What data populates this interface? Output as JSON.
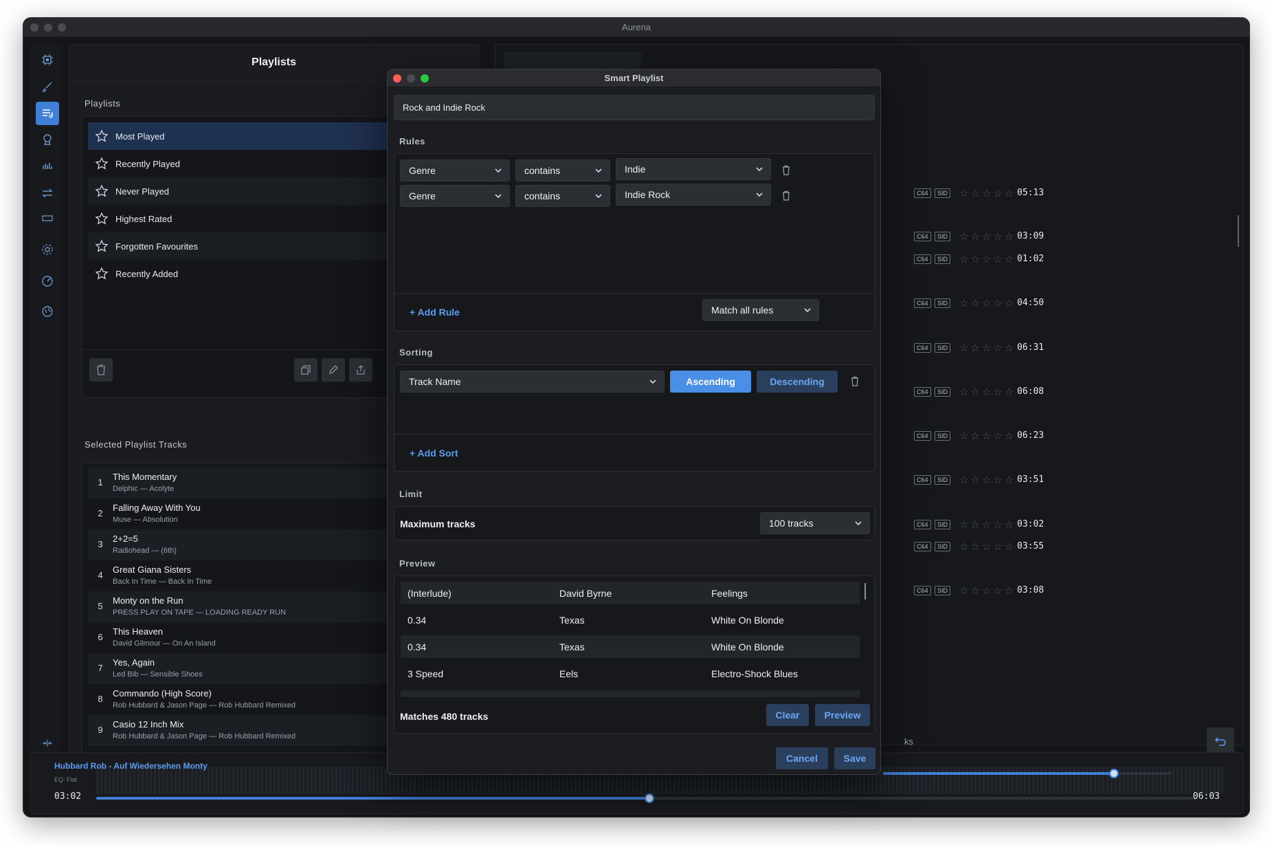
{
  "window": {
    "title": "Aurena"
  },
  "rail": {
    "icons": [
      "cpu-icon",
      "brush-icon",
      "playlist-icon",
      "library-icon",
      "equalizer-icon",
      "transfer-icon",
      "display-icon",
      "settings-icon",
      "dial-icon",
      "globe-icon",
      "collapse-icon"
    ]
  },
  "playlists_panel": {
    "header": "Playlists",
    "section_label": "Playlists",
    "items": [
      {
        "label": "Most Played"
      },
      {
        "label": "Recently Played"
      },
      {
        "label": "Never Played"
      },
      {
        "label": "Highest Rated"
      },
      {
        "label": "Forgotten Favourites"
      },
      {
        "label": "Recently Added"
      }
    ],
    "tracks_label": "Selected Playlist Tracks",
    "tracks": [
      {
        "num": "1",
        "title": "This Momentary",
        "sub": "Delphic — Acolyte"
      },
      {
        "num": "2",
        "title": "Falling Away With You",
        "sub": "Muse — Absolution"
      },
      {
        "num": "3",
        "title": "2+2=5",
        "sub": "Radiohead — (6th)"
      },
      {
        "num": "4",
        "title": "Great Giana Sisters",
        "sub": "Back In Time — Back In Time"
      },
      {
        "num": "5",
        "title": "Monty on the Run",
        "sub": "PRESS PLAY ON TAPE — LOADING READY RUN"
      },
      {
        "num": "6",
        "title": "This Heaven",
        "sub": "David Gilmour — On An Island"
      },
      {
        "num": "7",
        "title": "Yes, Again",
        "sub": "Led Bib — Sensible Shoes"
      },
      {
        "num": "8",
        "title": "Commando (High Score)",
        "sub": "Rob Hubbard & Jason Page — Rob Hubbard Remixed"
      },
      {
        "num": "9",
        "title": "Casio 12 Inch Mix",
        "sub": "Rob Hubbard & Jason Page — Rob Hubbard Remixed"
      }
    ]
  },
  "right_panel": {
    "badges": [
      "C64",
      "SID"
    ],
    "stars": "☆☆☆☆☆",
    "times": [
      "05:13",
      "03:09",
      "01:02",
      "04:50",
      "06:31",
      "06:08",
      "06:23",
      "03:51",
      "03:02",
      "03:55",
      "03:08"
    ],
    "partial_text": "ks"
  },
  "player": {
    "now_playing": "Hubbard Rob - Auf Wiedersehen Monty",
    "eq": "EQ: Flat",
    "elapsed": "03:02",
    "duration": "06:03",
    "progress": 0.503,
    "volume": 0.8
  },
  "modal": {
    "title": "Smart Playlist",
    "name": "Rock and Indie Rock",
    "rules_label": "Rules",
    "rules": [
      {
        "field": "Genre",
        "op": "contains",
        "value": "Indie"
      },
      {
        "field": "Genre",
        "op": "contains",
        "value": "Indie Rock"
      }
    ],
    "add_rule": "+ Add Rule",
    "match_mode": "Match all rules",
    "sorting_label": "Sorting",
    "sort_field": "Track Name",
    "ascending": "Ascending",
    "descending": "Descending",
    "add_sort": "+ Add Sort",
    "limit_label": "Limit",
    "max_tracks_label": "Maximum tracks",
    "max_tracks_value": "100 tracks",
    "preview_label": "Preview",
    "preview_rows": [
      {
        "track": "(Interlude)",
        "artist": "David Byrne",
        "album": "Feelings"
      },
      {
        "track": "0.34",
        "artist": "Texas",
        "album": "White On Blonde"
      },
      {
        "track": "0.34",
        "artist": "Texas",
        "album": "White On Blonde"
      },
      {
        "track": "3 Speed",
        "artist": "Eels",
        "album": "Electro-Shock Blues"
      }
    ],
    "matches": "Matches 480 tracks",
    "clear": "Clear",
    "preview_btn": "Preview",
    "cancel": "Cancel",
    "save": "Save",
    "colors": {
      "accent": "#4a8fe6",
      "close": "#ff5f57",
      "minimize": "#4a4c50",
      "zoom": "#28c840"
    }
  }
}
